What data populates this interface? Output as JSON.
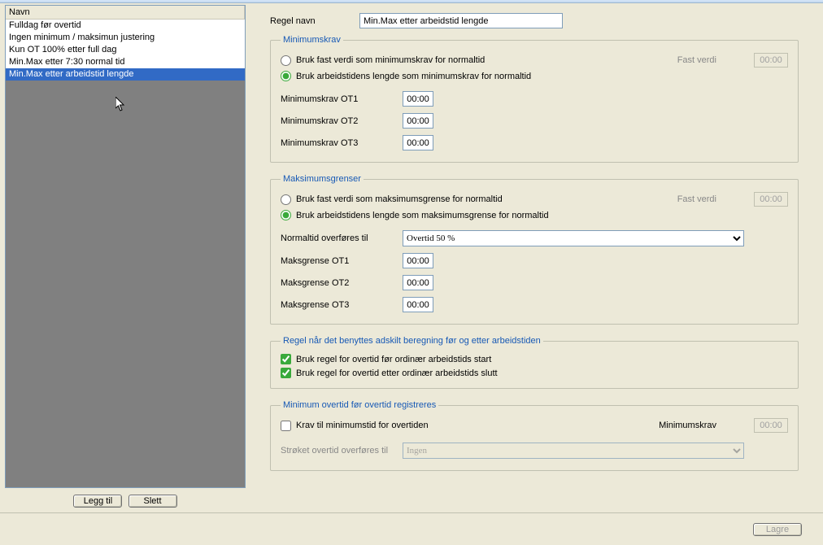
{
  "list": {
    "header": "Navn",
    "items": [
      "Fulldag før overtid",
      "Ingen minimum / maksimun justering",
      "Kun OT 100% etter full dag",
      "Min.Max etter 7:30 normal tid",
      "Min.Max etter arbeidstid lengde"
    ],
    "selected_index": 4
  },
  "buttons": {
    "add": "Legg til",
    "delete": "Slett",
    "save": "Lagre"
  },
  "rule_name": {
    "label": "Regel navn",
    "value": "Min.Max etter arbeidstid lengde"
  },
  "min": {
    "legend": "Minimumskrav",
    "radio1": "Bruk fast verdi som minimumskrav for normaltid",
    "radio2": "Bruk arbeidstidens lengde som minimumskrav for normaltid",
    "fast_label": "Fast verdi",
    "fast_value": "00:00",
    "ot1_label": "Minimumskrav OT1",
    "ot1_value": "00:00",
    "ot2_label": "Minimumskrav OT2",
    "ot2_value": "00:00",
    "ot3_label": "Minimumskrav OT3",
    "ot3_value": "00:00"
  },
  "max": {
    "legend": "Maksimumsgrenser",
    "radio1": "Bruk fast verdi som maksimumsgrense for normaltid",
    "radio2": "Bruk arbeidstidens lengde som maksimumsgrense for normaltid",
    "fast_label": "Fast verdi",
    "fast_value": "00:00",
    "normal_label": "Normaltid overføres til",
    "normal_value": "Overtid 50 %",
    "ot1_label": "Maksgrense OT1",
    "ot1_value": "00:00",
    "ot2_label": "Maksgrense OT2",
    "ot2_value": "00:00",
    "ot3_label": "Maksgrense OT3",
    "ot3_value": "00:00"
  },
  "split": {
    "legend": "Regel når det benyttes adskilt beregning før og etter arbeidstiden",
    "chk1": "Bruk regel for overtid før ordinær arbeidstids start",
    "chk2": "Bruk regel for overtid etter ordinær arbeidstids slutt"
  },
  "minot": {
    "legend": "Minimum overtid før overtid registreres",
    "chk": "Krav til minimumstid for overtiden",
    "min_label": "Minimumskrav",
    "min_value": "00:00",
    "transfer_label": "Strøket overtid overføres til",
    "transfer_value": "Ingen"
  }
}
